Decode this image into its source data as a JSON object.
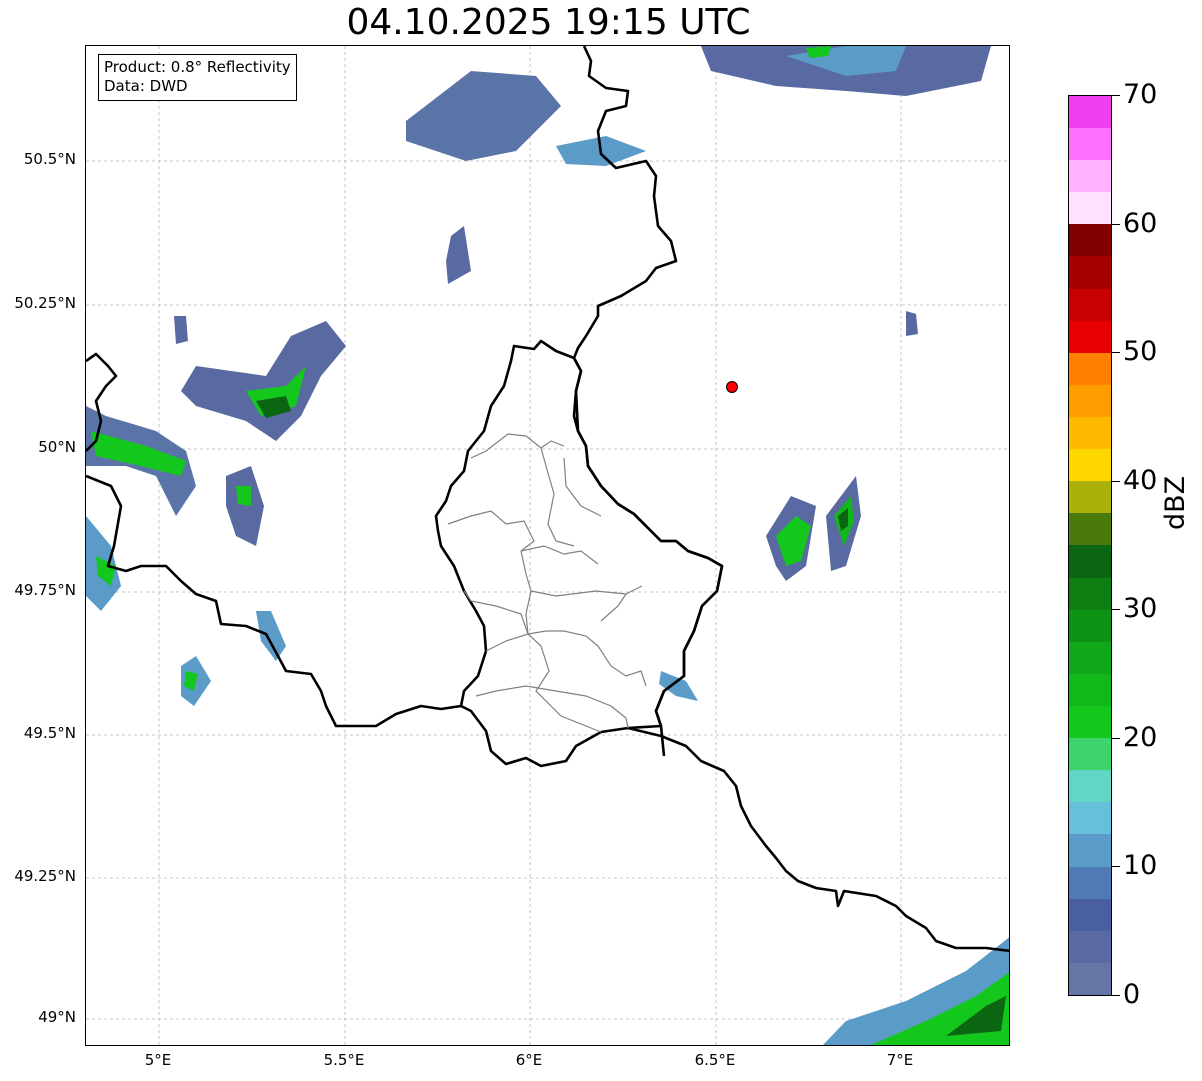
{
  "title": "04.10.2025 19:15 UTC",
  "info": {
    "product": "Product: 0.8° Reflectivity",
    "source": "Data: DWD"
  },
  "axes": {
    "lat_labels": [
      "50.5°N",
      "50.25°N",
      "50°N",
      "49.75°N",
      "49.5°N",
      "49.25°N",
      "49°N"
    ],
    "lon_labels": [
      "5°E",
      "5.5°E",
      "6°E",
      "6.5°E",
      "7°E"
    ]
  },
  "colorbar": {
    "label": "dBZ",
    "ticks": [
      "0",
      "10",
      "20",
      "30",
      "40",
      "50",
      "60",
      "70"
    ],
    "colors": [
      "#6674a6",
      "#586aa1",
      "#4a5fa0",
      "#4f7ab3",
      "#5a9bc8",
      "#66c0dc",
      "#62d6c4",
      "#3ed46c",
      "#14c71c",
      "#12b81a",
      "#10a818",
      "#0e9214",
      "#0c7e12",
      "#0b6612",
      "#4a7a0c",
      "#aab10a",
      "#ffd700",
      "#ffba00",
      "#ff9c00",
      "#ff7f00",
      "#e60000",
      "#c80000",
      "#a50000",
      "#820000",
      "#ffe0ff",
      "#ffb3ff",
      "#ff70ff",
      "#ee3ef0"
    ]
  },
  "marker": {
    "color": "#ff0000"
  },
  "grid": true
}
